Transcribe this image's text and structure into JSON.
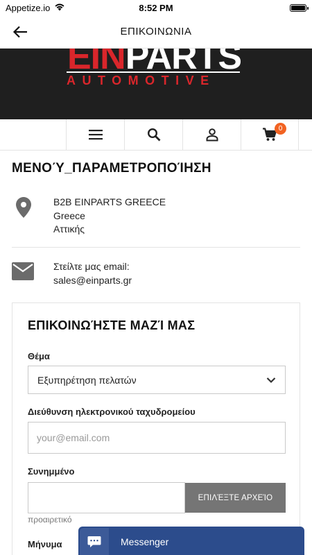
{
  "status_bar": {
    "carrier": "Appetize.io",
    "time": "8:52 PM"
  },
  "header": {
    "title": "ΕΠΙΚΟΙΝΩΝΙΑ"
  },
  "banner": {
    "logo_part1": "EIN",
    "logo_part2": "PARTS",
    "logo_sub": "AUTOMOTIVE"
  },
  "toolbar": {
    "cart_count": "0"
  },
  "page": {
    "title": "ΜΕΝΟΎ_ΠΑΡΑΜΕΤΡΟΠΟΊΗΣΗ"
  },
  "contact": {
    "address_lines": [
      "B2B EINPARTS GREECE",
      "Greece",
      "Αττικής"
    ],
    "email_label": "Στείλτε μας email:",
    "email": "sales@einparts.gr"
  },
  "form": {
    "title": "ΕΠΙΚΟΙΝΩΉΣΤΕ ΜΑΖΊ ΜΑΣ",
    "subject_label": "Θέμα",
    "subject_value": "Εξυπηρέτηση πελατών",
    "email_label": "Διεύθυνση ηλεκτρονικού ταχυδρομείου",
    "email_placeholder": "your@email.com",
    "attachment_label": "Συνημμένο",
    "file_button": "ΕΠΙΛΈΞΤΕ ΑΡΧΕΊΟ",
    "attachment_hint": "προαιρετικό",
    "message_label": "Μήνυμα"
  },
  "messenger": {
    "label": "Messenger"
  },
  "colors": {
    "accent": "#f26322",
    "brand_red": "#d9262b",
    "messenger": "#2c4c8c"
  }
}
